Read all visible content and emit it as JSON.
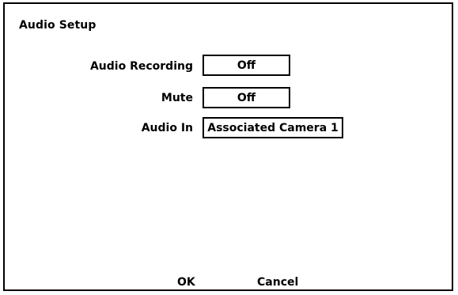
{
  "dialog": {
    "title": "Audio Setup",
    "rows": [
      {
        "label": "Audio Recording",
        "value": "Off"
      },
      {
        "label": "Mute",
        "value": "Off"
      },
      {
        "label": "Audio In",
        "value": "Associated Camera 1"
      }
    ],
    "buttons": {
      "ok_label": "OK",
      "cancel_label": "Cancel"
    }
  }
}
